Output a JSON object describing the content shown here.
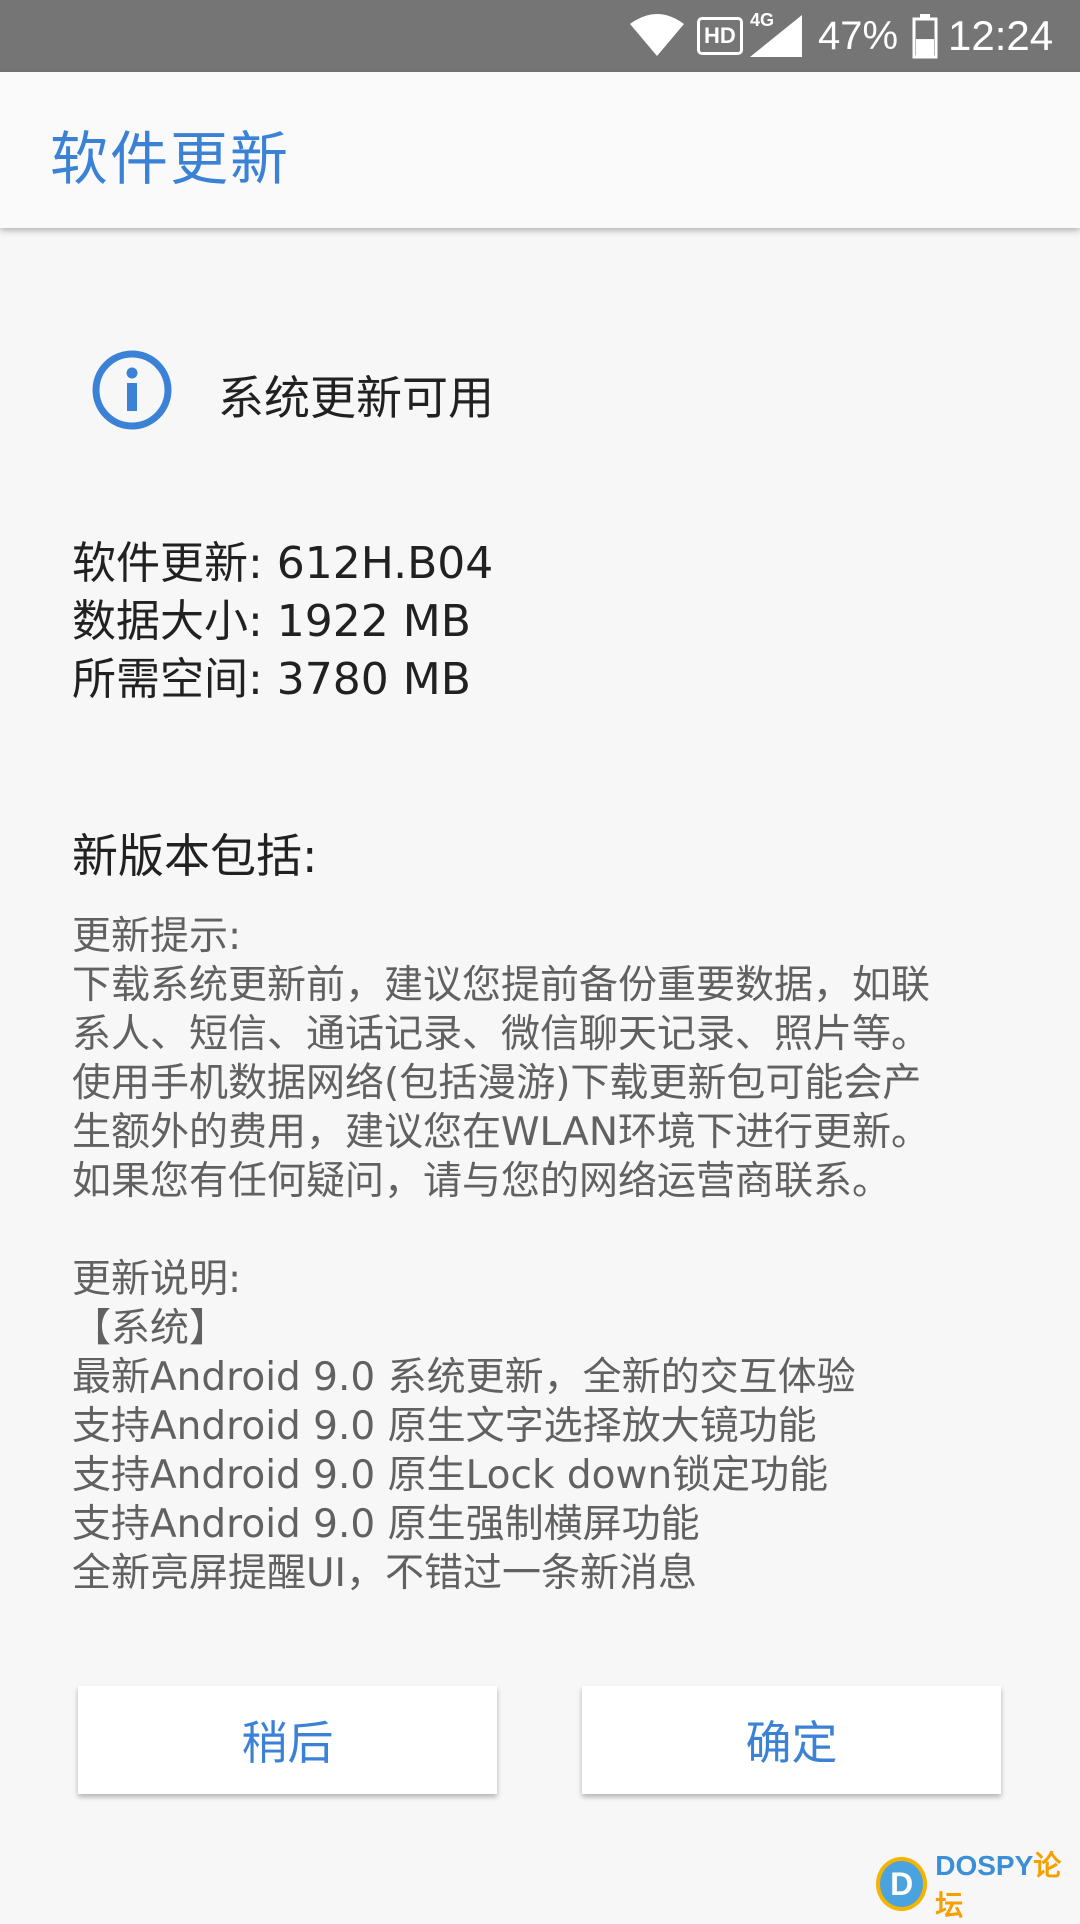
{
  "status_bar": {
    "network_type": "4G",
    "hd_label": "HD",
    "battery_percent": "47%",
    "battery_level": 0.47,
    "time": "12:24",
    "icons": [
      "wifi-icon",
      "hd-icon",
      "signal-icon",
      "battery-icon"
    ]
  },
  "app_bar": {
    "title": "软件更新"
  },
  "update": {
    "status_icon": "info-icon",
    "status_title": "系统更新可用",
    "version_line": "软件更新: 612H.B04",
    "size_line": "数据大小: 1922 MB",
    "space_line": "所需空间: 3780 MB"
  },
  "changelog": {
    "heading": "新版本包括:",
    "tips_heading": "更新提示:",
    "tips_lines": [
      "下载系统更新前，建议您提前备份重要数据，如联",
      "系人、短信、通话记录、微信聊天记录、照片等。",
      "使用手机数据网络(包括漫游)下载更新包可能会产",
      "生额外的费用，建议您在WLAN环境下进行更新。",
      "如果您有任何疑问，请与您的网络运营商联系。"
    ],
    "notes_heading": "更新说明:",
    "system_tag": "【系统】",
    "notes_lines": [
      "最新Android 9.0 系统更新，全新的交互体验",
      "支持Android 9.0 原生文字选择放大镜功能",
      "支持Android 9.0 原生Lock down锁定功能",
      "支持Android 9.0 原生强制横屏功能",
      "全新亮屏提醒UI，不错过一条新消息"
    ]
  },
  "buttons": {
    "later_label": "稍后",
    "ok_label": "确定"
  },
  "watermark": {
    "logo_letter": "D",
    "brand": "DOSPY",
    "brand_cn": "论坛"
  },
  "colors": {
    "accent": "#3b82d6",
    "status_bar": "#757575",
    "background": "#f7f7f7"
  }
}
